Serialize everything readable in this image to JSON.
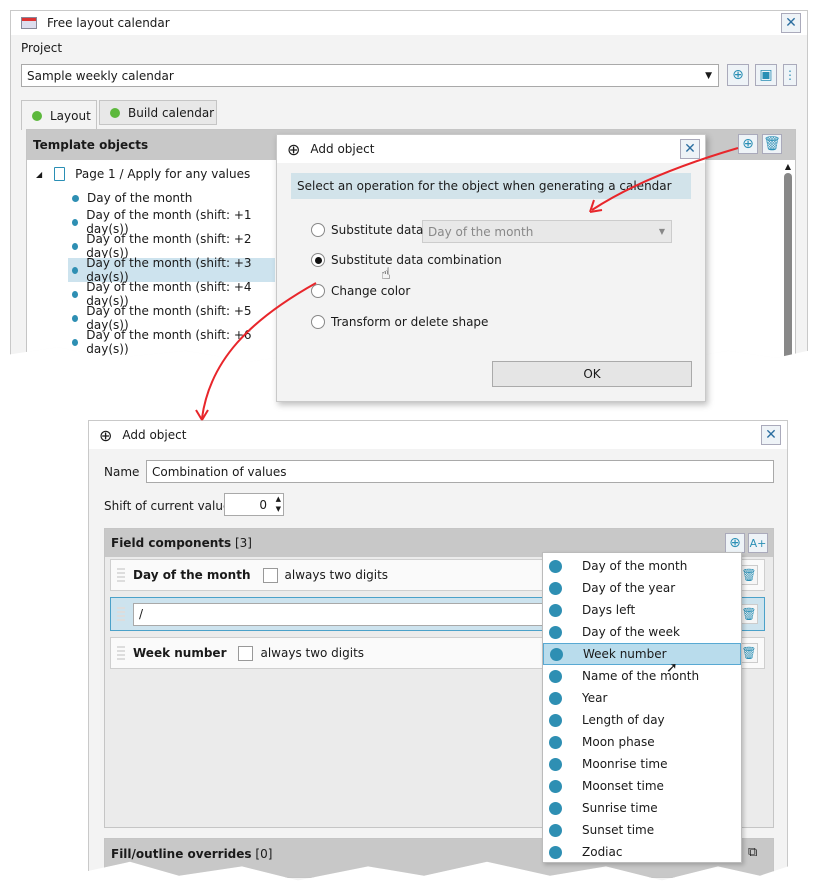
{
  "main_window": {
    "title": "Free layout calendar",
    "project_label": "Project",
    "project_value": "Sample weekly calendar",
    "tabs": [
      {
        "label": "Layout",
        "status_color": "#5cb83c"
      },
      {
        "label": "Build calendar",
        "status_color": "#5cb83c"
      }
    ],
    "panel_title": "Template objects",
    "tree": {
      "root": "Page 1 / Apply for any values",
      "items": [
        "Day of the month",
        "Day of the month (shift: +1 day(s))",
        "Day of the month (shift: +2 day(s))",
        "Day of the month (shift: +3 day(s))",
        "Day of the month (shift: +4 day(s))",
        "Day of the month (shift: +5 day(s))",
        "Day of the month (shift: +6 day(s))"
      ],
      "selected": 3
    }
  },
  "dialog1": {
    "title": "Add object",
    "info": "Select an operation for the object when generating a calendar",
    "options": [
      "Substitute data",
      "Substitute data combination",
      "Change color",
      "Transform or delete shape"
    ],
    "selected": 1,
    "combo_value": "Day of the month",
    "ok": "OK"
  },
  "dialog2": {
    "title": "Add object",
    "name_label": "Name",
    "name_value": "Combination of values",
    "shift_label": "Shift of current value",
    "shift_value": "0",
    "field_components": {
      "title": "Field components",
      "count": "[3]",
      "rows": [
        {
          "label": "Day of the month",
          "checkbox": "always two digits"
        },
        {
          "text_value": "/"
        },
        {
          "label": "Week number",
          "checkbox": "always two digits"
        }
      ]
    },
    "fill_overrides": {
      "title": "Fill/outline overrides",
      "count": "[0]"
    },
    "popup": {
      "items": [
        "Day of the month",
        "Day of the year",
        "Days left",
        "Day of the week",
        "Week number",
        "Name of the month",
        "Year",
        "Length of day",
        "Moon phase",
        "Moonrise time",
        "Moonset time",
        "Sunrise time",
        "Sunset time",
        "Zodiac"
      ],
      "hovered": 4
    }
  },
  "colors": {
    "accent": "#2e8fb3",
    "arrow": "#e8262b",
    "selection": "#cde3ee"
  }
}
